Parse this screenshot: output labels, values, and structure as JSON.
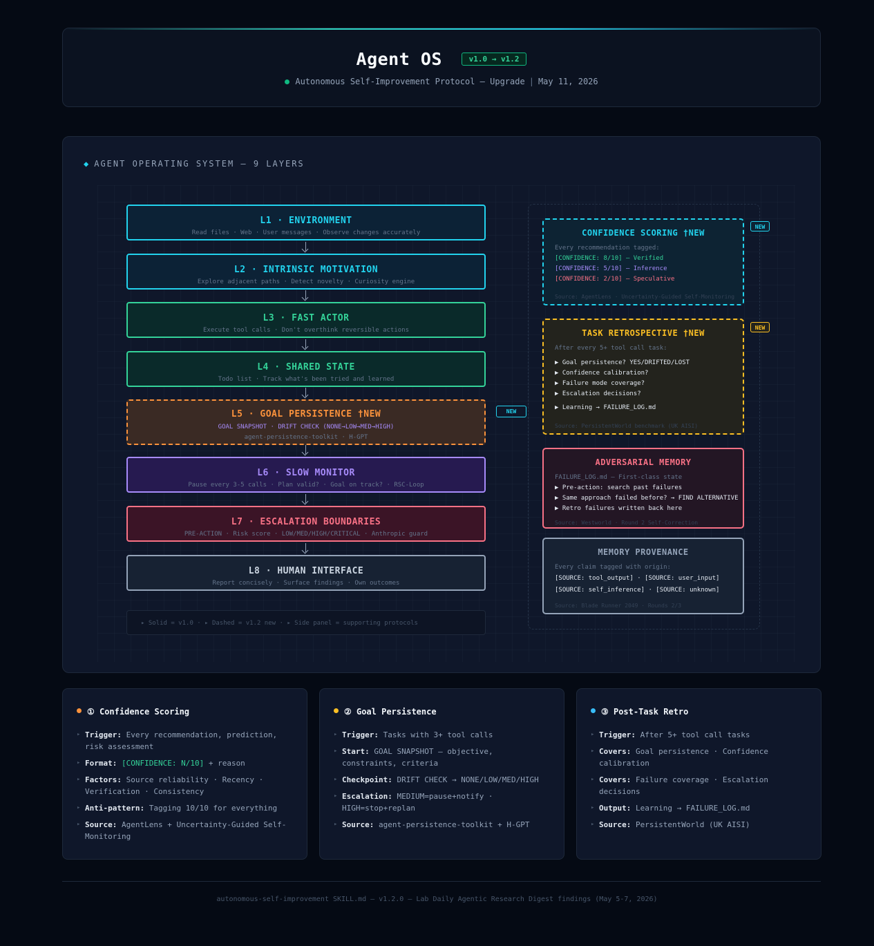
{
  "header": {
    "title": "Agent OS",
    "version": "v1.0 → v1.2",
    "subtitle_protocol": "Autonomous Self-Improvement Protocol — Upgrade",
    "separator": "|",
    "date": "May 11, 2026"
  },
  "diagram": {
    "section_icon": "◆",
    "section_title": "AGENT OPERATING SYSTEM — 9 LAYERS",
    "layers": [
      {
        "title": "L1 · ENVIRONMENT",
        "subtitle": "Read files · Web · User messages · Observe changes accurately"
      },
      {
        "title": "L2 · INTRINSIC MOTIVATION",
        "subtitle": "Explore adjacent paths · Detect novelty · Curiosity engine"
      },
      {
        "title": "L3 · FAST ACTOR",
        "subtitle": "Execute tool calls · Don't overthink reversible actions"
      },
      {
        "title": "L4 · SHARED STATE",
        "subtitle": "Todo list · Track what's been tried and learned"
      },
      {
        "title": "L5 · GOAL PERSISTENCE †NEW",
        "subtitle": "GOAL SNAPSHOT · DRIFT CHECK (NONE→LOW→MED→HIGH)",
        "subtitle2": "agent-persistence-toolkit · H-GPT"
      },
      {
        "title": "L6 · SLOW MONITOR",
        "subtitle": "Pause every 3-5 calls · Plan valid? · Goal on track? · RSC-Loop"
      },
      {
        "title": "L7 · ESCALATION BOUNDARIES",
        "subtitle": "PRE-ACTION · Risk score · LOW/MED/HIGH/CRITICAL · Anthropic guard"
      },
      {
        "title": "L8 · HUMAN INTERFACE",
        "subtitle": "Report concisely · Surface findings · Own outcomes"
      }
    ],
    "l5_new_tag": "NEW",
    "legend": "▸ Solid = v1.0 · ▸ Dashed = v1.2 new · ▸ Side panel = supporting protocols",
    "side_cards": {
      "confidence": {
        "title": "CONFIDENCE SCORING †NEW",
        "tag": "NEW",
        "lead": "Every recommendation tagged:",
        "rows": [
          "[CONFIDENCE: 8/10] — Verified",
          "[CONFIDENCE: 5/10] — Inference",
          "[CONFIDENCE: 2/10] — Speculative"
        ],
        "source": "Source: AgentLens · Uncertainty-Guided Self-Monitoring"
      },
      "retro": {
        "title": "TASK RETROSPECTIVE †NEW",
        "tag": "NEW",
        "lead": "After every 5+ tool call task:",
        "rows": [
          "▶ Goal persistence? YES/DRIFTED/LOST",
          "▶ Confidence calibration?",
          "▶ Failure mode coverage?",
          "▶ Escalation decisions?"
        ],
        "extra": "▶ Learning → FAILURE_LOG.md",
        "source": "Source: PersistentWorld benchmark (UK AISI)"
      },
      "adversarial": {
        "title": "ADVERSARIAL MEMORY",
        "lead": "FAILURE_LOG.md — First-class state",
        "rows": [
          "▶ Pre-action: search past failures",
          "▶ Same approach failed before? → FIND ALTERNATIVE",
          "▶ Retro failures written back here"
        ],
        "source": "Source: Westworld · Round 2 Self-Correction"
      },
      "provenance": {
        "title": "MEMORY PROVENANCE",
        "lead": "Every claim tagged with origin:",
        "rows": [
          "[SOURCE: tool_output] · [SOURCE: user_input]",
          "[SOURCE: self_inference] · [SOURCE: unknown]"
        ],
        "source": "Source: Blade Runner 2049 · Rounds 2/3"
      }
    },
    "colors": {
      "cyan": "#22d3ee",
      "green": "#34d399",
      "orange": "#fb923c",
      "purple": "#a78bfa",
      "red": "#f87185",
      "gray": "#94a3b8",
      "amber": "#fbbf24",
      "verified": "#34d399",
      "inference": "#a78bfa",
      "speculative": "#f87185"
    }
  },
  "details": [
    {
      "title": "① Confidence Scoring",
      "dot_color": "#fb923c",
      "items": [
        {
          "label": "Trigger:",
          "text": "Every recommendation, prediction, risk assessment"
        },
        {
          "label": "Format:",
          "highlight": "[CONFIDENCE: N/10]",
          "text": "+ reason"
        },
        {
          "label": "Factors:",
          "text": "Source reliability · Recency · Verification · Consistency"
        },
        {
          "label": "Anti-pattern:",
          "text": "Tagging 10/10 for everything"
        },
        {
          "label": "Source:",
          "text": "AgentLens + Uncertainty-Guided Self-Monitoring"
        }
      ]
    },
    {
      "title": "② Goal Persistence",
      "dot_color": "#fbbf24",
      "items": [
        {
          "label": "Trigger:",
          "text": "Tasks with 3+ tool calls"
        },
        {
          "label": "Start:",
          "text": "GOAL SNAPSHOT — objective, constraints, criteria"
        },
        {
          "label": "Checkpoint:",
          "text": "DRIFT CHECK → NONE/LOW/MED/HIGH"
        },
        {
          "label": "Escalation:",
          "text": "MEDIUM=pause+notify · HIGH=stop+replan"
        },
        {
          "label": "Source:",
          "text": "agent-persistence-toolkit + H-GPT"
        }
      ]
    },
    {
      "title": "③ Post-Task Retro",
      "dot_color": "#38bdf8",
      "items": [
        {
          "label": "Trigger:",
          "text": "After 5+ tool call tasks"
        },
        {
          "label": "Covers:",
          "text": "Goal persistence · Confidence calibration"
        },
        {
          "label": "Covers:",
          "text": "Failure coverage · Escalation decisions"
        },
        {
          "label": "Output:",
          "text": "Learning → FAILURE_LOG.md"
        },
        {
          "label": "Source:",
          "text": "PersistentWorld (UK AISI)"
        }
      ]
    }
  ],
  "footer": "autonomous-self-improvement SKILL.md — v1.2.0 — Lab Daily Agentic Research Digest findings (May 5-7, 2026)"
}
